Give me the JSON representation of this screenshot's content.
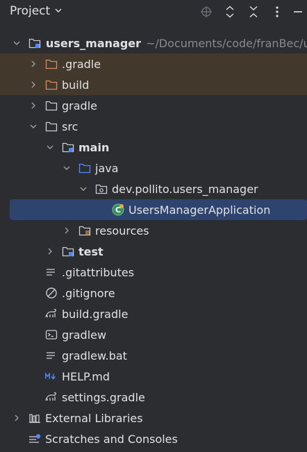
{
  "header": {
    "title": "Project"
  },
  "tree": {
    "root": {
      "label": "users_manager",
      "path": "~/Documents/code/franBec/u"
    },
    "gradle_hidden": ".gradle",
    "build": "build",
    "gradle": "gradle",
    "src": "src",
    "main": "main",
    "java": "java",
    "package": "dev.pollito.users_manager",
    "app_class": "UsersManagerApplication",
    "resources": "resources",
    "test": "test",
    "gitattributes": ".gitattributes",
    "gitignore": ".gitignore",
    "build_gradle": "build.gradle",
    "gradlew": "gradlew",
    "gradlew_bat": "gradlew.bat",
    "help_md": "HELP.md",
    "settings_gradle": "settings.gradle",
    "external_libraries": "External Libraries",
    "scratches": "Scratches and Consoles"
  },
  "colors": {
    "background": "#2b2d30",
    "excluded_row": "#43382c",
    "selected_row": "#2e436e",
    "excluded_folder": "#e0895f",
    "source_folder": "#548af7",
    "text": "#dfe1e5",
    "muted": "#868a91"
  }
}
